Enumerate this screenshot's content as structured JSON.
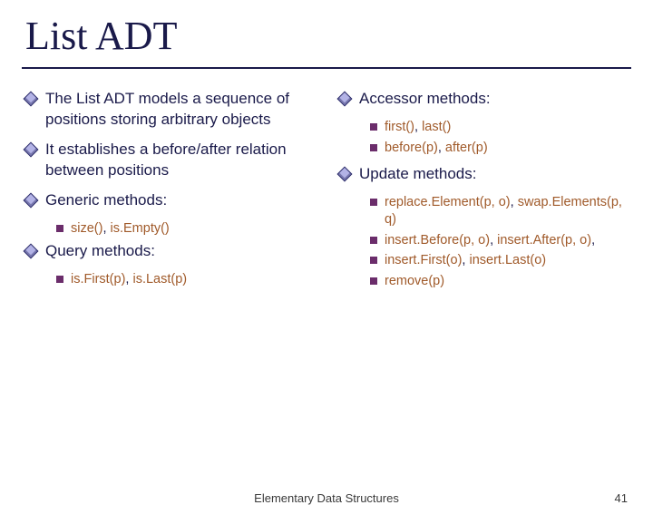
{
  "title": "List ADT",
  "col_left": {
    "p1": "The List ADT models a sequence of positions storing arbitrary objects",
    "p2": "It establishes a before/after relation between positions",
    "generic_hdr": "Generic methods:",
    "generic_1a": "size()",
    "generic_1b": ", ",
    "generic_1c": "is.Empty()",
    "query_hdr": "Query methods:",
    "query_1a": "is.First(p)",
    "query_1b": ", ",
    "query_1c": "is.Last(p)"
  },
  "col_right": {
    "accessor_hdr": "Accessor methods:",
    "acc_1a": "first()",
    "acc_1b": ", ",
    "acc_1c": "last()",
    "acc_2a": "before(p)",
    "acc_2b": ", ",
    "acc_2c": "after(p)",
    "update_hdr": "Update methods:",
    "upd_1a": "replace.Element(p, o)",
    "upd_1b": ", ",
    "upd_1c": "swap.Elements(p, q)",
    "upd_2a": "insert.Before(p, o)",
    "upd_2b": ", ",
    "upd_2c": "insert.After(p, o)",
    "upd_2d": ",",
    "upd_3a": "insert.First(o)",
    "upd_3b": ", ",
    "upd_3c": "insert.Last(o)",
    "upd_4": "remove(p)"
  },
  "footer": {
    "center": "Elementary Data Structures",
    "page": "41"
  }
}
